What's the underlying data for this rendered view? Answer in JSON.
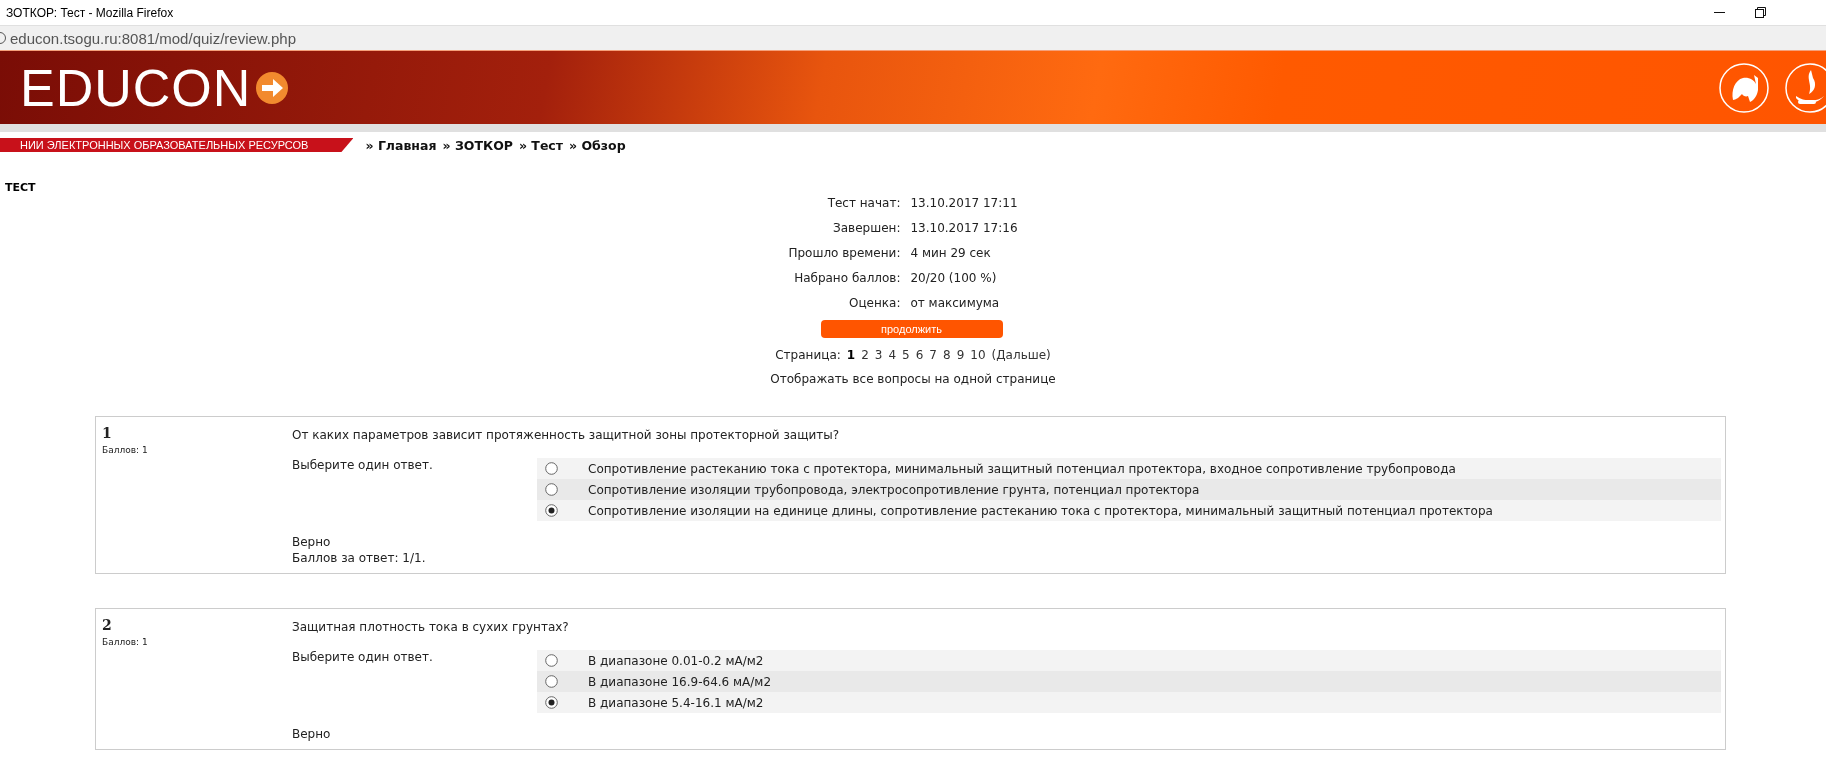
{
  "window": {
    "title": "ЗОТКОР: Тест - Mozilla Firefox"
  },
  "address_bar": {
    "url": "educon.tsogu.ru:8081/mod/quiz/review.php"
  },
  "banner": {
    "logo": "EDUCON"
  },
  "nav": {
    "tagline": "НИИ ЭЛЕКТРОННЫХ ОБРАЗОВАТЕЛЬНЫХ РЕСУРСОВ",
    "breadcrumb": [
      "» Главная",
      "» ЗОТКОР",
      "» Тест",
      "» Обзор"
    ]
  },
  "page_title": "ТЕСТ",
  "summary": [
    {
      "label": "Тест начат:",
      "value": "13.10.2017 17:11"
    },
    {
      "label": "Завершен:",
      "value": "13.10.2017 17:16"
    },
    {
      "label": "Прошло времени:",
      "value": "4 мин 29 сек"
    },
    {
      "label": "Набрано баллов:",
      "value": "20/20 (100 %)"
    },
    {
      "label": "Оценка:",
      "value": "от максимума"
    }
  ],
  "continue_button": "продолжить",
  "pager": {
    "label": "Страница:",
    "pages": [
      {
        "label": "1",
        "selected": true
      },
      {
        "label": "2",
        "selected": false
      },
      {
        "label": "3",
        "selected": false
      },
      {
        "label": "4",
        "selected": false
      },
      {
        "label": "5",
        "selected": false
      },
      {
        "label": "6",
        "selected": false
      },
      {
        "label": "7",
        "selected": false
      },
      {
        "label": "8",
        "selected": false
      },
      {
        "label": "9",
        "selected": false
      },
      {
        "label": "10",
        "selected": false
      }
    ],
    "next": "(Дальше)",
    "show_all": "Отображать все вопросы на одной странице"
  },
  "questions": [
    {
      "number": "1",
      "marks": "Баллов: 1",
      "text": "От каких параметров зависит протяженность защитной зоны протекторной защиты?",
      "prompt": "Выберите один ответ.",
      "options": [
        {
          "text": "Сопротивление растеканию тока с протектора, минимальный защитный потенциал протектора, входное сопротивление трубопровода",
          "selected": false
        },
        {
          "text": "Сопротивление изоляции трубопровода, электросопротивление грунта, потенциал протектора",
          "selected": false
        },
        {
          "text": "Сопротивление изоляции на единице длины, сопротивление растеканию тока с протектора, минимальный защитный потенциал протектора",
          "selected": true
        }
      ],
      "feedback": "Верно",
      "score": "Баллов за ответ: 1/1."
    },
    {
      "number": "2",
      "marks": "Баллов: 1",
      "text": "Защитная плотность тока в сухих грунтах?",
      "prompt": "Выберите один ответ.",
      "options": [
        {
          "text": "В диапазоне 0.01-0.2 мА/м2",
          "selected": false
        },
        {
          "text": "В диапазоне 16.9-64.6 мА/м2",
          "selected": false
        },
        {
          "text": "В диапазоне 5.4-16.1 мА/м2",
          "selected": true
        }
      ],
      "feedback": "Верно"
    }
  ]
}
